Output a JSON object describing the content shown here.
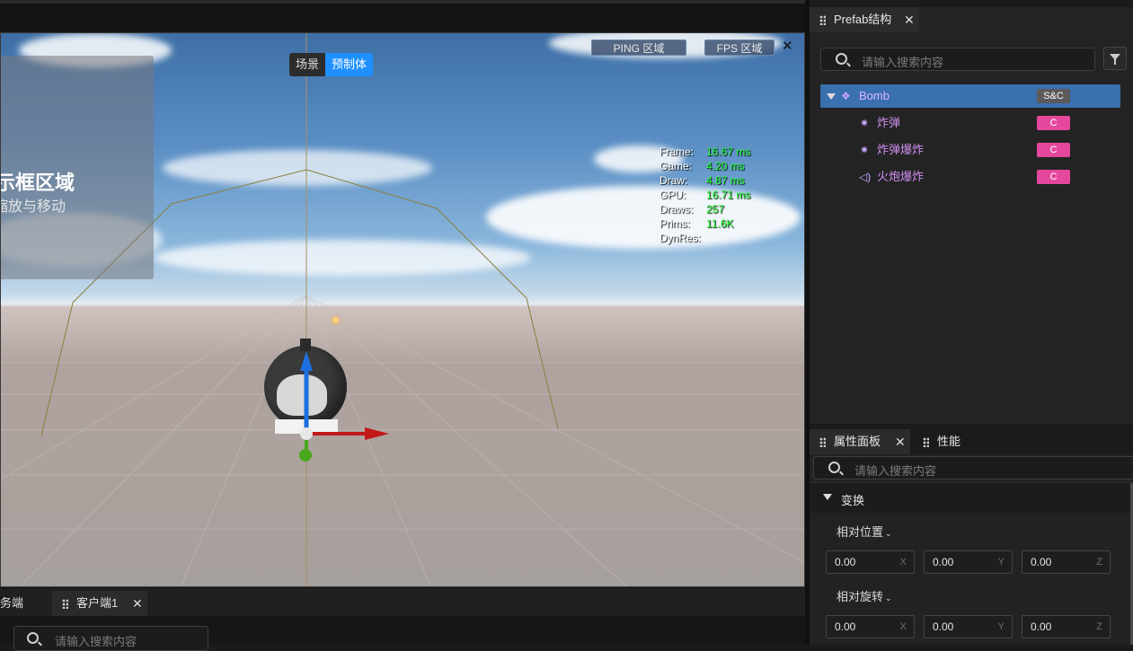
{
  "viewport": {
    "overlay_title": "示框区域",
    "overlay_subtitle": "缩放与移动",
    "mode_scene": "场景",
    "mode_prefab": "预制体",
    "ping_label": "PING 区域",
    "fps_label": "FPS 区域",
    "close": "✕",
    "stats": [
      {
        "k": "Frame:",
        "v": "16.67 ms"
      },
      {
        "k": "Game:",
        "v": "4.20 ms"
      },
      {
        "k": "Draw:",
        "v": "4.87 ms"
      },
      {
        "k": "GPU:",
        "v": "16.71 ms"
      },
      {
        "k": "Draws:",
        "v": "257"
      },
      {
        "k": "Prims:",
        "v": "11.6K"
      },
      {
        "k": "DynRes:",
        "v": ""
      }
    ]
  },
  "bottom": {
    "tab_server": "务端",
    "tab_client": "客户端1",
    "close": "✕",
    "search_placeholder": "请输入搜索内容"
  },
  "prefab_panel": {
    "title": "Prefab结构",
    "close": "✕",
    "search_placeholder": "请输入搜索内容",
    "items": [
      {
        "name": "Bomb",
        "badge": "S&C",
        "icon": "prefab-node-icon"
      },
      {
        "name": "炸弹",
        "badge": "C",
        "icon": "particle-effect-icon"
      },
      {
        "name": "炸弹爆炸",
        "badge": "C",
        "icon": "particle-effect-icon"
      },
      {
        "name": "火炮爆炸",
        "badge": "C",
        "icon": "sound-icon"
      }
    ]
  },
  "attr_panel": {
    "tab_props": "属性面板",
    "tab_perf": "性能",
    "close": "✕",
    "search_placeholder": "请输入搜索内容",
    "section": "变换",
    "rel_position": "相对位置",
    "rel_rotation": "相对旋转",
    "position": {
      "x": "0.00",
      "y": "0.00",
      "z": "0.00"
    },
    "rotation": {
      "x": "0.00",
      "y": "0.00",
      "z": "0.00"
    },
    "axis_x": "X",
    "axis_y": "Y",
    "axis_z": "Z"
  }
}
